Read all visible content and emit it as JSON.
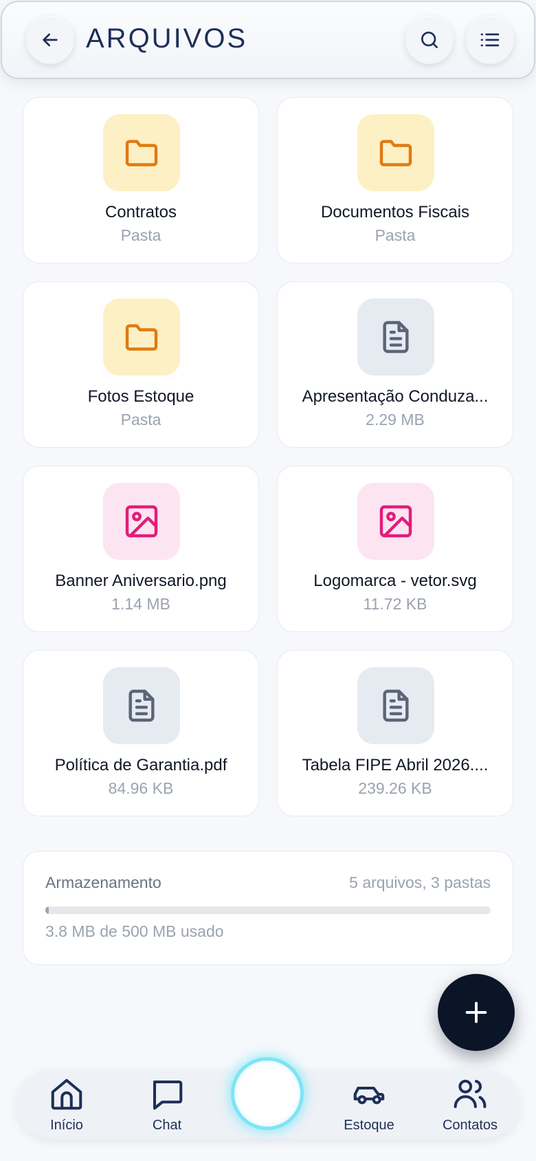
{
  "header": {
    "title": "ARQUIVOS",
    "back_icon": "arrow-left-icon",
    "search_icon": "search-icon",
    "menu_icon": "list-icon"
  },
  "files": [
    {
      "name": "Contratos",
      "meta": "Pasta",
      "kind": "folder"
    },
    {
      "name": "Documentos Fiscais",
      "meta": "Pasta",
      "kind": "folder"
    },
    {
      "name": "Fotos Estoque",
      "meta": "Pasta",
      "kind": "folder"
    },
    {
      "name": "Apresentação Conduza...",
      "meta": "2.29 MB",
      "kind": "doc"
    },
    {
      "name": "Banner Aniversario.png",
      "meta": "1.14 MB",
      "kind": "image"
    },
    {
      "name": "Logomarca - vetor.svg",
      "meta": "11.72 KB",
      "kind": "image"
    },
    {
      "name": "Política de Garantia.pdf",
      "meta": "84.96 KB",
      "kind": "doc"
    },
    {
      "name": "Tabela FIPE Abril 2026....",
      "meta": "239.26 KB",
      "kind": "doc"
    }
  ],
  "storage": {
    "label": "Armazenamento",
    "count": "5 arquivos, 3 pastas",
    "used_text": "3.8 MB de 500 MB usado",
    "used_fraction": 0.0076
  },
  "fab": {
    "icon": "plus-icon"
  },
  "nav": {
    "inicio": "Início",
    "chat": "Chat",
    "estoque": "Estoque",
    "contatos": "Contatos"
  },
  "colors": {
    "folder_accent": "#e07a12",
    "folder_bg": "#fdf0c4",
    "doc_accent": "#5b6577",
    "doc_bg": "#e6ebf2",
    "image_accent": "#e11d7a",
    "image_bg": "#fce4f0",
    "nav_primary": "#1e2f57",
    "fab_bg": "#0b1528",
    "orb_glow": "#67e8f9"
  }
}
